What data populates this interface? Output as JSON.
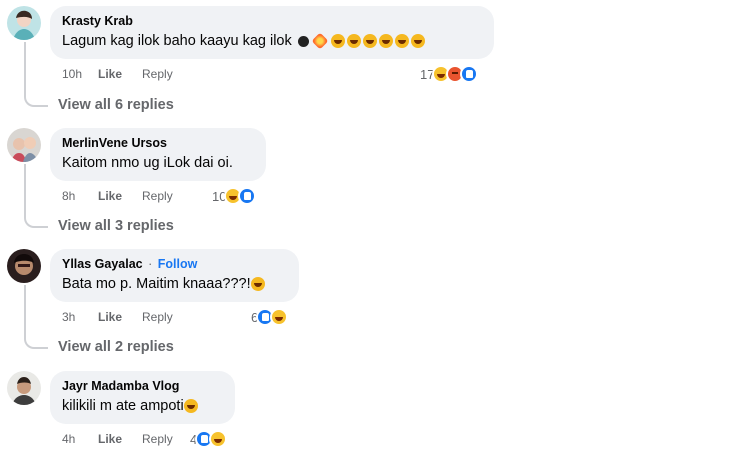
{
  "comments": [
    {
      "author": "Krasty Krab",
      "text": "Lagum kag ilok baho kaayu kag ilok",
      "emoji": [
        "bomb-icon",
        "collision-icon",
        "laugh-icon",
        "laugh-icon",
        "laugh-icon",
        "laugh-icon",
        "laugh-icon",
        "laugh-icon"
      ],
      "time": "10h",
      "like_label": "Like",
      "reply_label": "Reply",
      "reaction_count": "17",
      "reactions": [
        "haha",
        "angry",
        "like"
      ],
      "view_replies": "View all 6 replies"
    },
    {
      "author": "MerlinVene Ursos",
      "text": "Kaitom nmo ug iLok dai oi.",
      "emoji": [],
      "time": "8h",
      "like_label": "Like",
      "reply_label": "Reply",
      "reaction_count": "10",
      "reactions": [
        "haha",
        "like"
      ],
      "view_replies": "View all 3 replies"
    },
    {
      "author": "Yllas Gayalac",
      "separator": "·",
      "follow_label": "Follow",
      "text": "Bata mo p. Maitim knaaa???!",
      "emoji": [
        "laugh-icon"
      ],
      "time": "3h",
      "like_label": "Like",
      "reply_label": "Reply",
      "reaction_count": "6",
      "reactions": [
        "like",
        "haha"
      ],
      "view_replies": "View all 2 replies"
    },
    {
      "author": "Jayr Madamba Vlog",
      "text": "kilikili m ate ampoti",
      "emoji": [
        "laugh-icon"
      ],
      "time": "4h",
      "like_label": "Like",
      "reply_label": "Reply",
      "reaction_count": "4",
      "reactions": [
        "like",
        "haha"
      ]
    }
  ],
  "colors": {
    "bubble": "#f0f2f5",
    "meta_text": "#65676b",
    "follow": "#1877f2",
    "thread_line": "#ced0d4"
  }
}
